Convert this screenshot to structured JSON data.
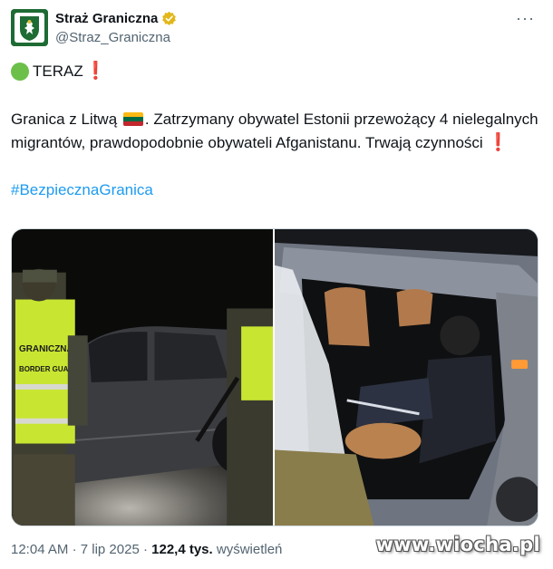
{
  "account": {
    "display_name": "Straż Graniczna",
    "handle": "@Straz_Graniczna",
    "verified_icon": "gold-check-badge-icon",
    "avatar_color": "#1e6b34",
    "more_label": "···"
  },
  "tweet": {
    "teraz": "TERAZ",
    "text_part1": "Granica z Litwą",
    "text_part2": ". Zatrzymany obywatel Estonii przewożący 4 nielegalnych migrantów, prawdopodobnie obywateli Afganistanu. Trwają czynności",
    "hashtag": "#BezpiecznaGranica",
    "emoji_green_circle": "green-circle-icon",
    "emoji_exclamation": "❗",
    "emoji_flag": "lithuania-flag-icon",
    "flag_colors": [
      "#fdb913",
      "#006a44",
      "#c1272d"
    ]
  },
  "media": {
    "vest_left_text_1": "GRANICZNA",
    "vest_left_text_2": "BORDER GUARD"
  },
  "meta": {
    "time": "12:04 AM",
    "sep": "·",
    "date": "7 lip 2025",
    "views_count": "122,4 tys.",
    "views_label": "wyświetleń"
  },
  "watermark": "www.wiocha.pl",
  "colors": {
    "link": "#1d9bf0",
    "muted": "#536471",
    "text": "#0f1419",
    "vest": "#c8e631",
    "exclamation": "#e0242b"
  }
}
